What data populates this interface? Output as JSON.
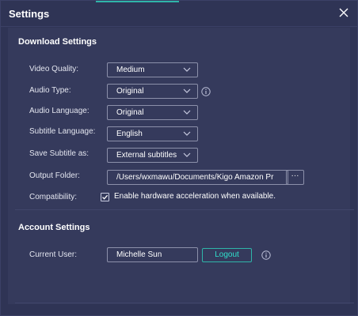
{
  "window": {
    "title": "Settings",
    "close_icon": "close-icon",
    "accent_color": "#2fb5a9"
  },
  "download_settings": {
    "section_title": "Download Settings",
    "video_quality": {
      "label": "Video Quality:",
      "value": "Medium"
    },
    "audio_type": {
      "label": "Audio Type:",
      "value": "Original",
      "info_icon": "info-icon"
    },
    "audio_language": {
      "label": "Audio Language:",
      "value": "Original"
    },
    "subtitle_language": {
      "label": "Subtitle Language:",
      "value": "English"
    },
    "save_subtitle_as": {
      "label": "Save Subtitle as:",
      "value": "External subtitles"
    },
    "output_folder": {
      "label": "Output Folder:",
      "value": "/Users/wxmawu/Documents/Kigo Amazon Pr",
      "browse_label": "···"
    },
    "compatibility": {
      "label": "Compatibility:",
      "checkbox_label": "Enable hardware acceleration when available.",
      "checked": true
    }
  },
  "account_settings": {
    "section_title": "Account Settings",
    "current_user": {
      "label": "Current User:",
      "value": "Michelle Sun"
    },
    "logout_label": "Logout",
    "info_icon": "info-icon"
  }
}
